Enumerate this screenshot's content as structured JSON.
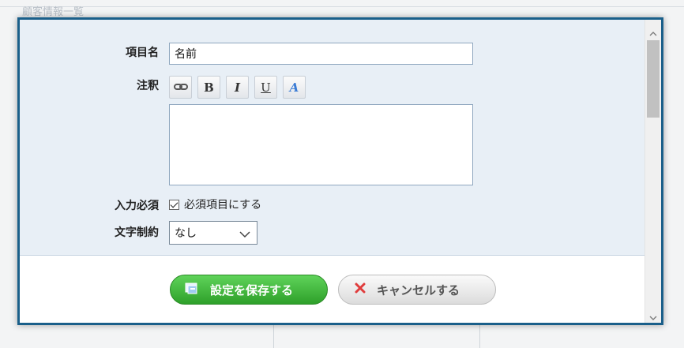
{
  "background": {
    "faded_heading": "顧客情報一覧"
  },
  "form": {
    "item_name": {
      "label": "項目名",
      "value": "名前"
    },
    "annotation": {
      "label": "注釈",
      "toolbar": {
        "link_icon": "link-icon",
        "bold_label": "B",
        "italic_label": "I",
        "underline_label": "U",
        "color_label": "A"
      },
      "value": ""
    },
    "required": {
      "label": "入力必須",
      "checkbox_label": "必須項目にする",
      "checked": true
    },
    "char_limit": {
      "label": "文字制約",
      "selected": "なし"
    }
  },
  "actions": {
    "save_label": "設定を保存する",
    "cancel_label": "キャンセルする"
  },
  "colors": {
    "modal_border": "#1a5f8a",
    "form_bg": "#e8eff6",
    "save_green": "#2ea02a",
    "cancel_red": "#e03c3c"
  }
}
